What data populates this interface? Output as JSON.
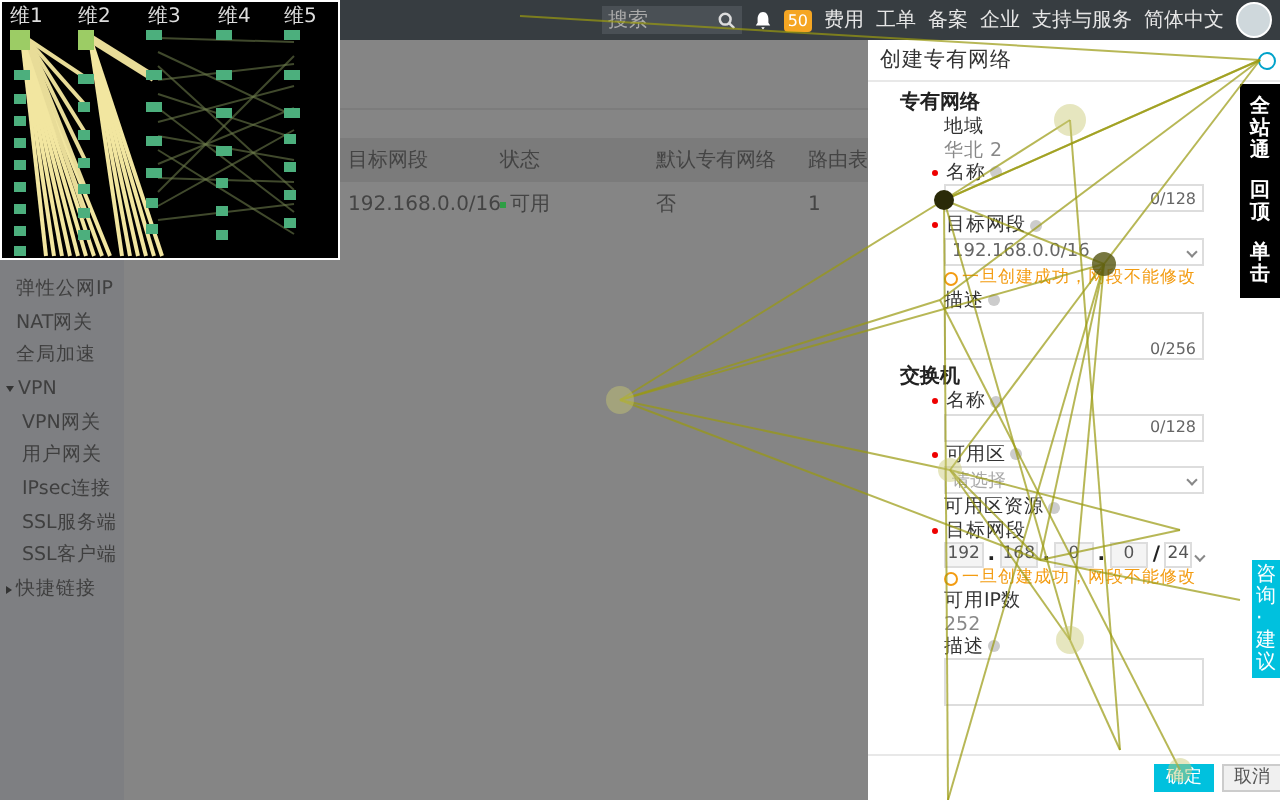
{
  "header": {
    "search": {
      "placeholder": "搜索"
    },
    "notification_count": "50",
    "nav": [
      "费用",
      "工单",
      "备案",
      "企业",
      "支持与服务",
      "简体中文"
    ]
  },
  "sidebar": {
    "items": [
      {
        "label": "弹性公网IP"
      },
      {
        "label": "NAT网关"
      },
      {
        "label": "全局加速"
      },
      {
        "label": "VPN",
        "expanded": true,
        "children": [
          {
            "label": "VPN网关"
          },
          {
            "label": "用户网关"
          },
          {
            "label": "IPsec连接"
          },
          {
            "label": "SSL服务端"
          },
          {
            "label": "SSL客户端"
          }
        ]
      },
      {
        "label": "快捷链接",
        "expanded": false
      }
    ]
  },
  "table": {
    "columns": [
      "目标网段",
      "状态",
      "默认专有网络",
      "路由表"
    ],
    "rows": [
      [
        "192.168.0.0/16",
        "可用",
        "否",
        "1"
      ]
    ]
  },
  "overlay_chart": {
    "axes": [
      "维1",
      "维2",
      "维3",
      "维4",
      "维5"
    ]
  },
  "panel": {
    "title": "创建专有网络",
    "sections": [
      {
        "title": "专有网络",
        "fields": [
          {
            "kind": "static",
            "label": "地域",
            "value": "华北 2",
            "required": false,
            "help": false
          },
          {
            "kind": "input",
            "label": "名称",
            "counter": "0/128",
            "required": true,
            "help": true
          },
          {
            "kind": "select",
            "label": "目标网段",
            "value": "192.168.0.0/16",
            "required": true,
            "help": true,
            "warning": "一旦创建成功，网段不能修改"
          },
          {
            "kind": "textarea",
            "label": "描述",
            "counter": "0/256",
            "required": false,
            "help": true
          }
        ]
      },
      {
        "title": "交换机",
        "fields": [
          {
            "kind": "input",
            "label": "名称",
            "counter": "0/128",
            "required": true,
            "help": true
          },
          {
            "kind": "select",
            "label": "可用区",
            "placeholder": "请选择",
            "required": true,
            "help": true
          },
          {
            "kind": "static",
            "label": "可用区资源",
            "required": false,
            "help": true
          },
          {
            "kind": "ip",
            "label": "目标网段",
            "octets": [
              "192",
              "168",
              "0",
              "0"
            ],
            "separator": ".",
            "mask_separator": "/",
            "mask": "24",
            "required": true,
            "help": false,
            "warning": "一旦创建成功，网段不能修改"
          },
          {
            "kind": "static",
            "label": "可用IP数",
            "value": "252",
            "required": false,
            "help": false
          },
          {
            "kind": "textarea",
            "label": "描述",
            "required": false,
            "help": true
          }
        ]
      }
    ],
    "buttons": [
      {
        "label": "确定",
        "primary": true
      },
      {
        "label": "取消",
        "primary": false
      }
    ]
  },
  "side_tools": [
    "全站通",
    "回顶",
    "单击"
  ],
  "feedback_tab": "咨询·建议"
}
